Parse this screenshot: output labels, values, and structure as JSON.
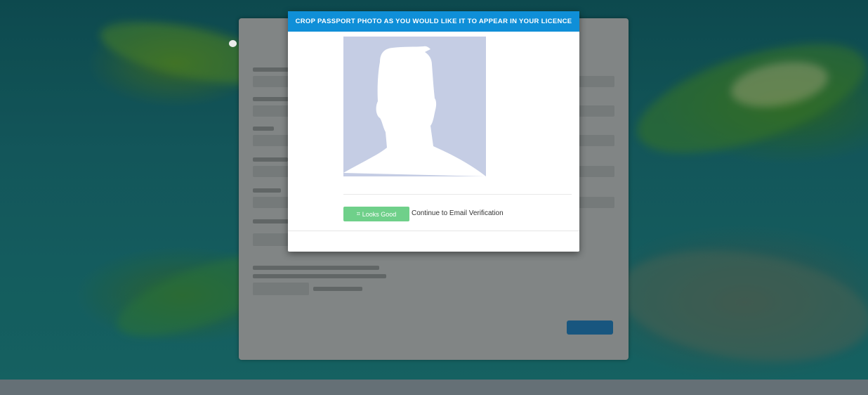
{
  "modal": {
    "title": "CROP PASSPORT PHOTO AS YOU WOULD LIKE IT TO APPEAR IN YOUR LICENCE",
    "photo_icon": "person-silhouette-placeholder",
    "looks_good_label": "Looks Good",
    "looks_good_icon": "crop-icon",
    "continue_text": "Continue to Email Verification"
  },
  "colors": {
    "header_bg": "#0f8fd8",
    "looks_good_bg": "#6fd08a",
    "photo_bg": "#c5cde4",
    "silhouette": "#ffffff"
  }
}
